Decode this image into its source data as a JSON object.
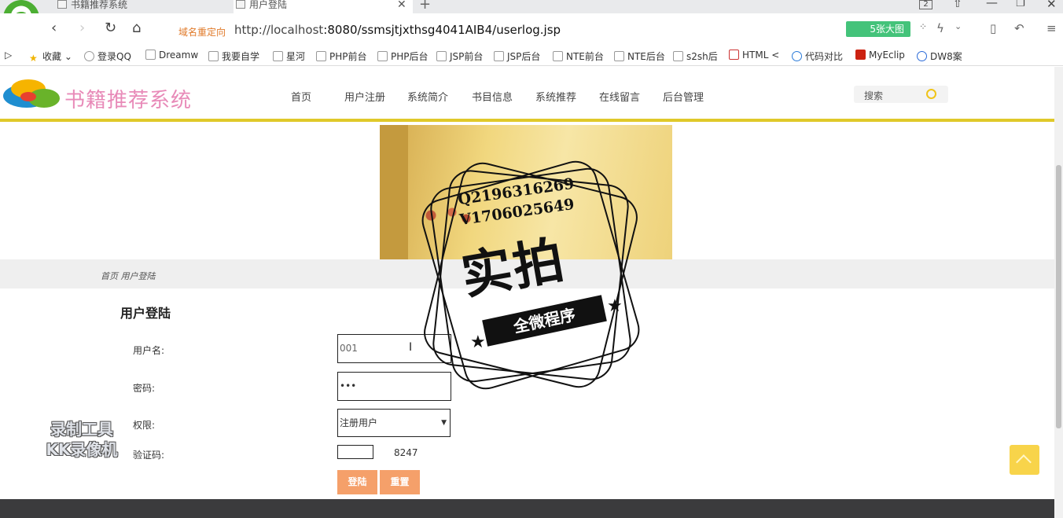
{
  "browser": {
    "logo_letter": "e",
    "tabs": [
      {
        "label": "书籍推荐系统"
      },
      {
        "label": "用户登陆"
      }
    ],
    "tab_count": "2",
    "redirect_label": "域名重定向",
    "url_host": "http://localhost",
    "url_path": ":8080/ssmsjtjxthsg4041AIB4/userlog.jsp",
    "bigpic_label": "5张大图",
    "bookmarks": [
      "收藏",
      "登录QQ",
      "Dreamw",
      "我要自学",
      "星河",
      "PHP前台",
      "PHP后台",
      "JSP前台",
      "JSP后台",
      "NTE前台",
      "NTE后台",
      "s2sh后",
      "HTML <",
      "代码对比",
      "MyEclip",
      "DW8案"
    ]
  },
  "site": {
    "title": "书籍推荐系统",
    "nav": [
      "首页",
      "用户注册",
      "系统简介",
      "书目信息",
      "系统推荐",
      "在线留言",
      "后台管理"
    ],
    "search_placeholder": "搜索",
    "breadcrumb": "首页 用户登陆"
  },
  "login_form": {
    "title": "用户登陆",
    "username_label": "用户名:",
    "username_value": "001",
    "password_label": "密码:",
    "password_value": "•••",
    "role_label": "权限:",
    "role_selected": "注册用户",
    "captcha_label": "验证码:",
    "captcha_value": "",
    "captcha_code": "8247",
    "login_button": "登陆",
    "reset_button": "重置"
  },
  "overlays": {
    "stamp_qq": "Q2196316269",
    "stamp_vx": "V1706025649",
    "stamp_big": "实拍",
    "stamp_ribbon": "全微程序",
    "recorder_line1": "录制工具",
    "recorder_line2": "KK录像机"
  }
}
